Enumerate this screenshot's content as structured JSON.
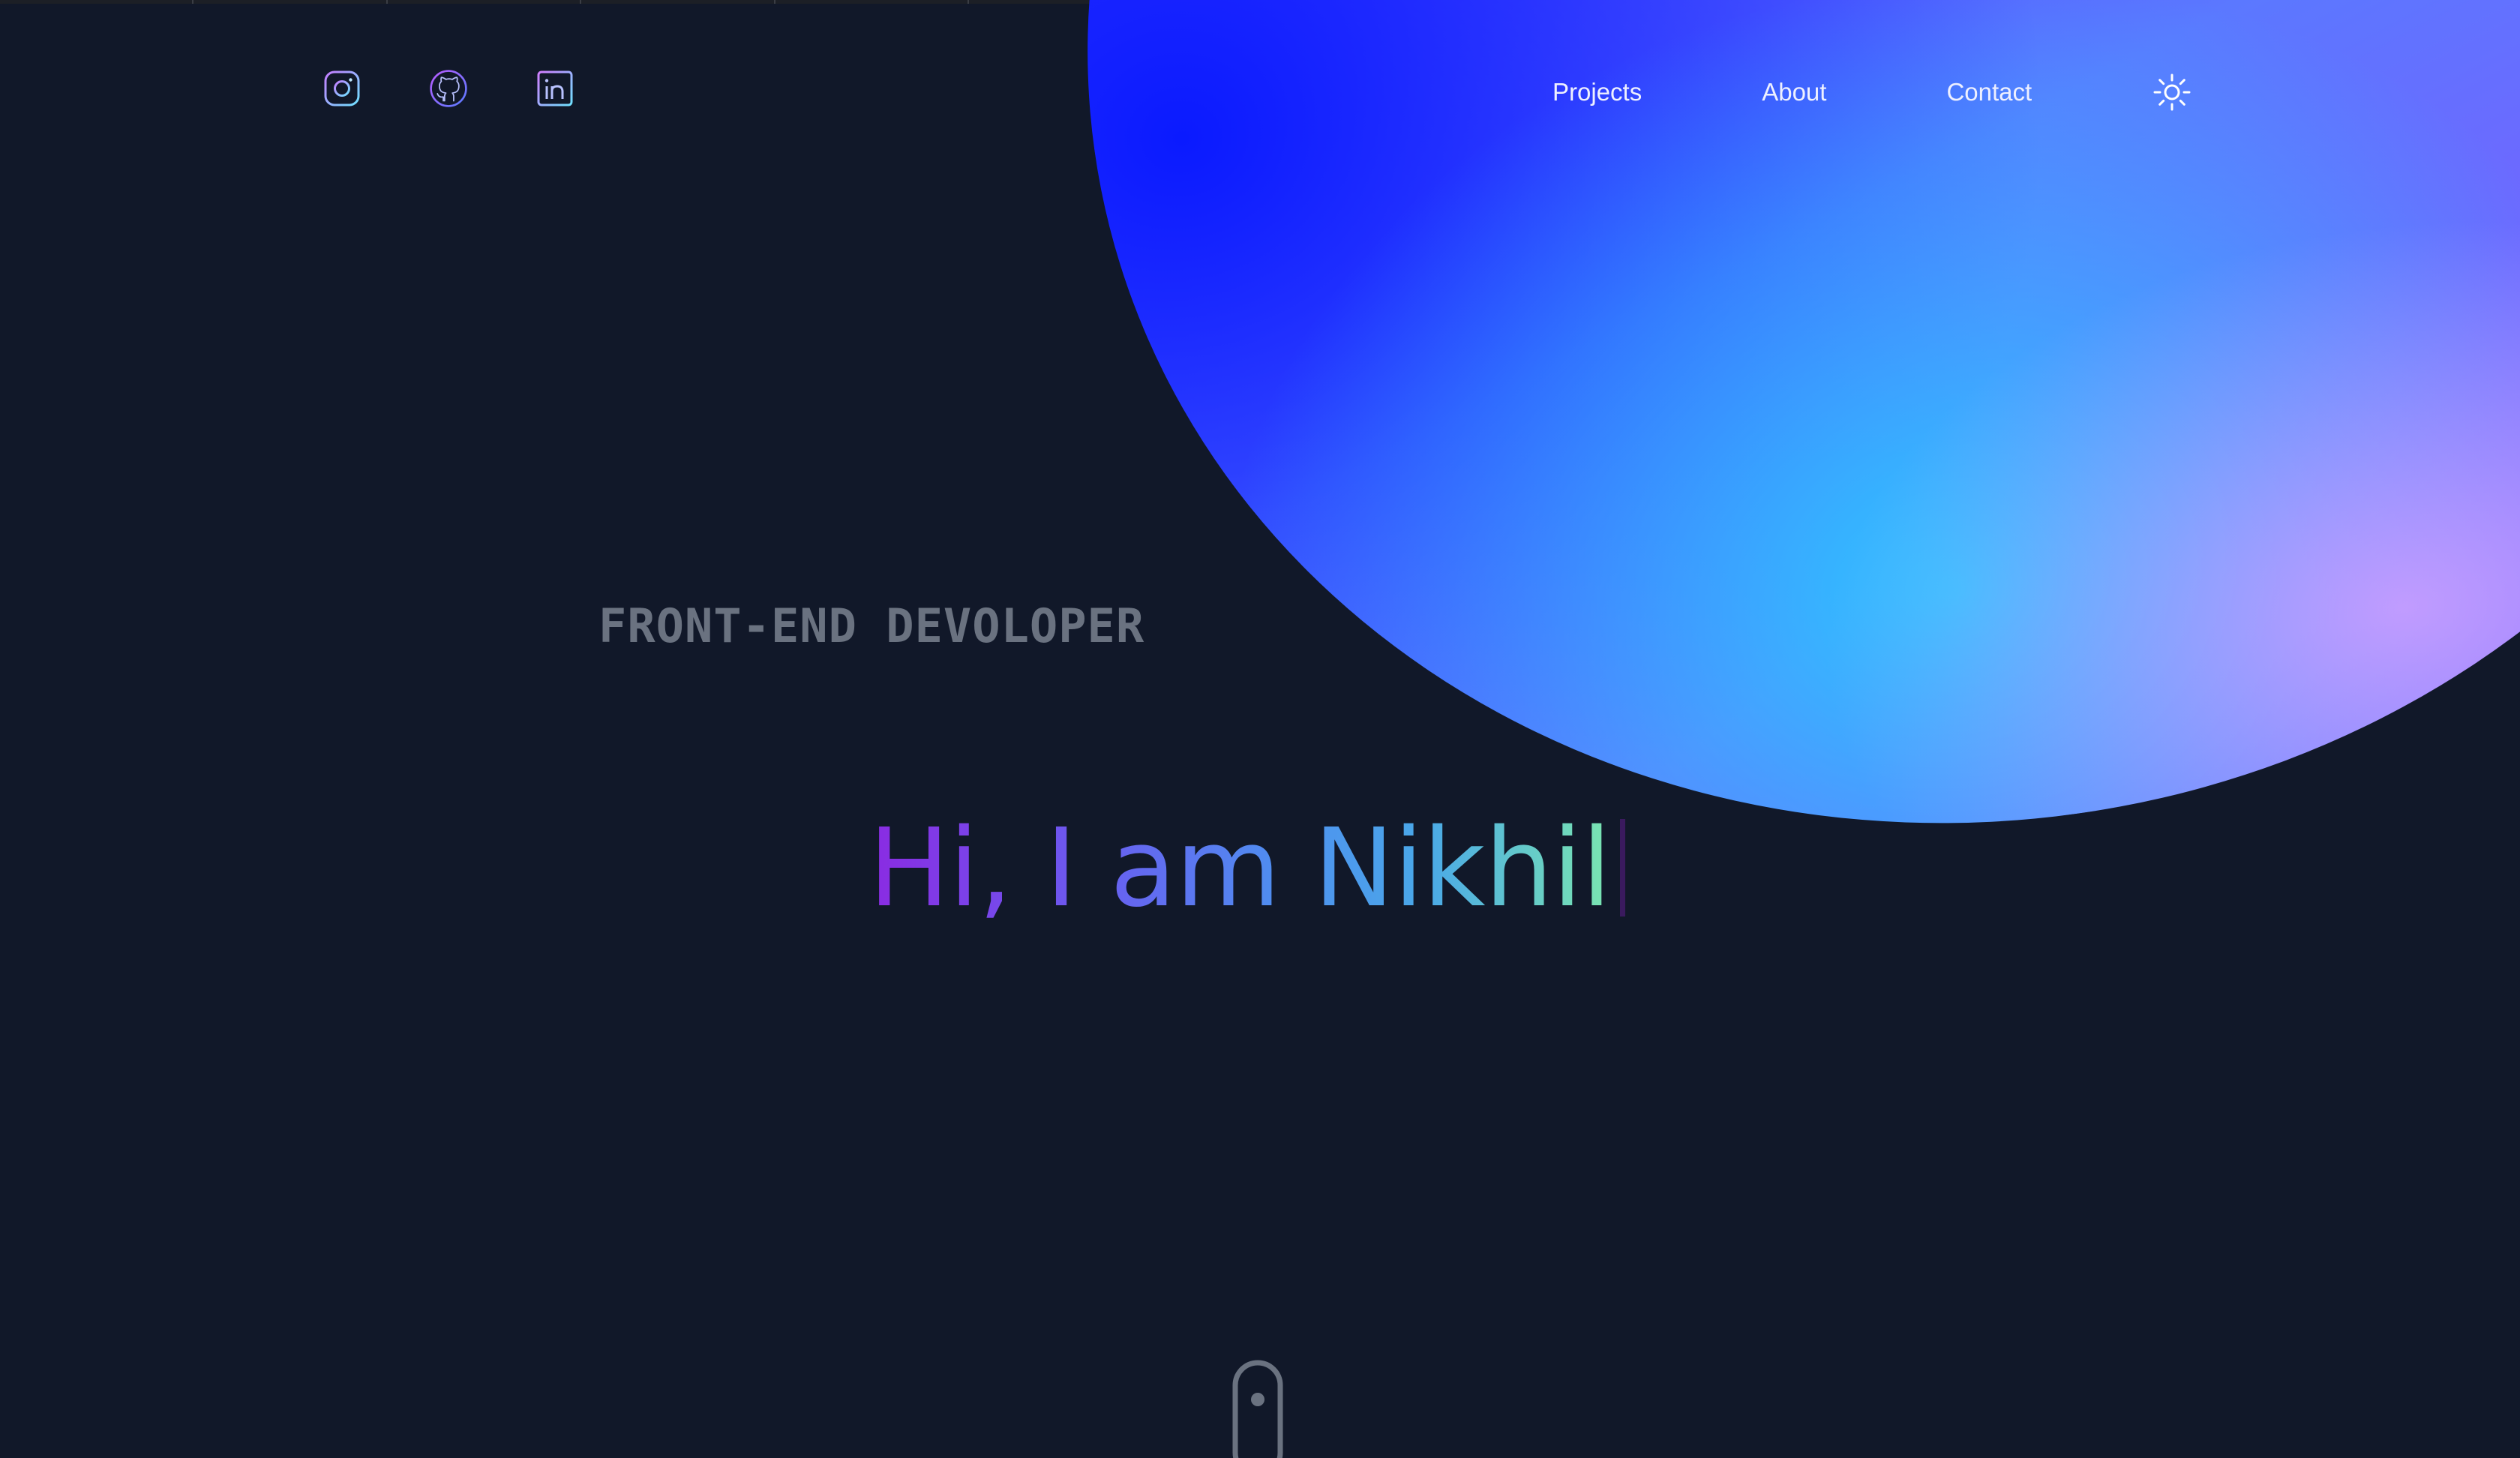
{
  "header": {
    "socials": [
      {
        "name": "instagram",
        "icon": "instagram-icon"
      },
      {
        "name": "github",
        "icon": "github-icon"
      },
      {
        "name": "linkedin",
        "icon": "linkedin-icon"
      }
    ],
    "nav": {
      "projects_label": "Projects",
      "about_label": "About",
      "contact_label": "Contact"
    },
    "theme_toggle_icon": "sun-icon"
  },
  "hero": {
    "role": "FRONT-END DEVOLOPER",
    "greeting": "Hi, I am Nikhil"
  },
  "scroll_indicator_icon": "mouse-scroll-icon",
  "colors": {
    "background": "#111829",
    "muted_text": "#6a7280",
    "nav_text": "#eef0ff",
    "gradient_start": "#8a2be2",
    "gradient_mid": "#4f8ef0",
    "gradient_end": "#7be6b0",
    "blob_primary": "#2a18ff",
    "blob_secondary": "#7a5dff",
    "blob_highlight": "#28c8ff"
  }
}
